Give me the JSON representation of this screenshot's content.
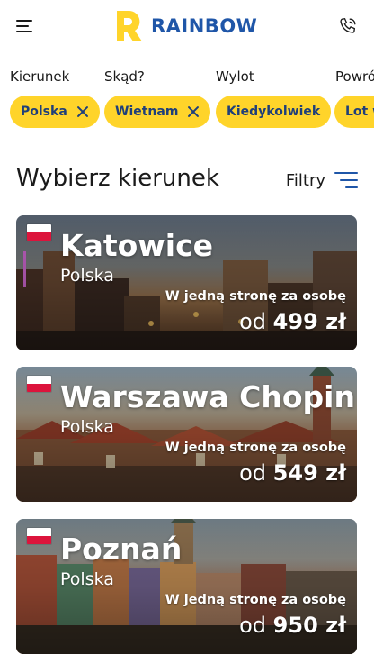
{
  "header": {
    "brand": "RAINBOW",
    "brand_color": "#1f56a8",
    "logo_color": "#ffd42a",
    "menu_icon": "hamburger-icon",
    "phone_icon": "phone-icon"
  },
  "filters": [
    {
      "label": "Kierunek",
      "value": "Polska",
      "removable": true
    },
    {
      "label": "Skąd?",
      "value": "Wietnam",
      "removable": true
    },
    {
      "label": "Wylot",
      "value": "Kiedykolwiek",
      "removable": false
    },
    {
      "label": "Powrót",
      "value": "Lot w",
      "removable": false
    }
  ],
  "section": {
    "title": "Wybierz kierunek",
    "filters_button": "Filtry"
  },
  "destinations": [
    {
      "city": "Katowice",
      "country": "Polska",
      "note": "W jedną stronę za osobę",
      "prefix": "od",
      "price": "499 zł"
    },
    {
      "city": "Warszawa Chopin",
      "country": "Polska",
      "note": "W jedną stronę za osobę",
      "prefix": "od",
      "price": "549 zł"
    },
    {
      "city": "Poznań",
      "country": "Polska",
      "note": "W jedną stronę za osobę",
      "prefix": "od",
      "price": "950 zł"
    }
  ],
  "colors": {
    "chip_bg": "#ffd42a",
    "chip_text": "#1f3f7a",
    "flag_white": "#ffffff",
    "flag_red": "#dc143c"
  }
}
